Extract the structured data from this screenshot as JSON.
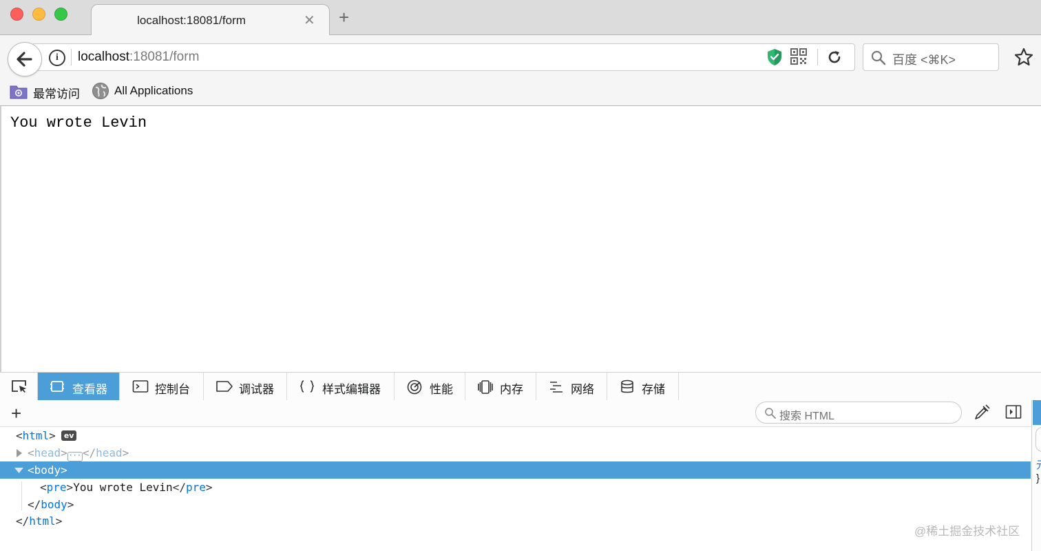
{
  "browser": {
    "tab_title": "localhost:18081/form",
    "tab_close_glyph": "✕",
    "new_tab_glyph": "+",
    "url_host": "localhost",
    "url_rest": ":18081/form",
    "search_placeholder": "百度 <⌘K>",
    "info_glyph": "i",
    "bookmarks": [
      "最常访问",
      "All Applications"
    ]
  },
  "page": {
    "pre_text": "You wrote Levin"
  },
  "devtools": {
    "tabs": [
      {
        "label": "查看器",
        "icon": "inspector-icon",
        "selected": true
      },
      {
        "label": "控制台",
        "icon": "console-icon"
      },
      {
        "label": "调试器",
        "icon": "debugger-icon"
      },
      {
        "label": "样式编辑器",
        "icon": "style-editor-icon"
      },
      {
        "label": "性能",
        "icon": "performance-icon"
      },
      {
        "label": "内存",
        "icon": "memory-icon"
      },
      {
        "label": "网络",
        "icon": "network-icon"
      },
      {
        "label": "存储",
        "icon": "storage-icon"
      }
    ],
    "add_glyph": "+",
    "search_placeholder": "搜索 HTML",
    "markup": {
      "html_open": "html",
      "ev_badge": "ev",
      "head": "head",
      "ellipsis": "···",
      "body": "body",
      "pre": "pre",
      "pre_text": "You wrote Levin"
    },
    "sidebar_text": [
      "元",
      "}"
    ]
  },
  "watermark": "@稀土掘金技术社区",
  "colors": {
    "accent": "#4c9ed9",
    "tag": "#0074e8"
  }
}
